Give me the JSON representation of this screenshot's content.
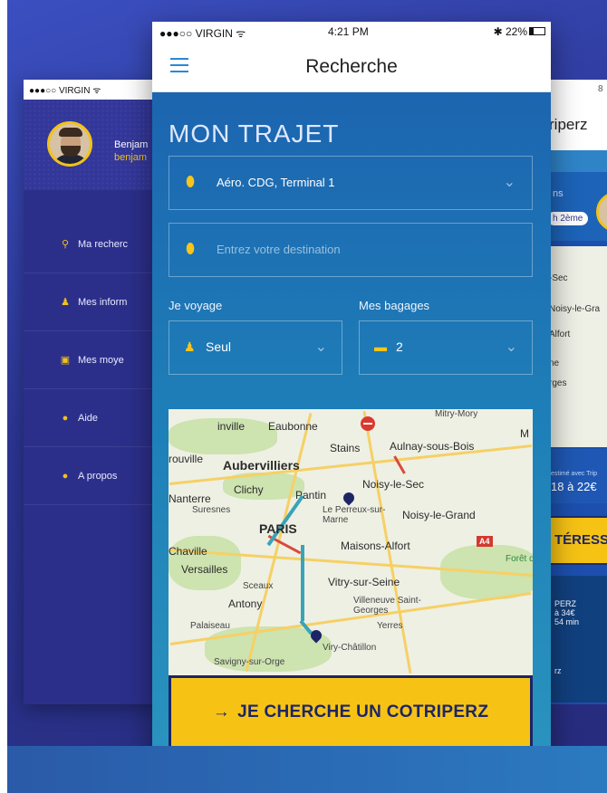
{
  "main": {
    "status": {
      "carrier": "●●●○○ VIRGIN ᯤ",
      "time": "4:21 PM",
      "battery": "✱ 22%"
    },
    "nav_title": "Recherche",
    "section_title": "MON TRAJET",
    "origin_value": "Aéro. CDG, Terminal 1",
    "destination_placeholder": "Entrez votre destination",
    "travel_label": "Je voyage",
    "travel_value": "Seul",
    "bags_label": "Mes bagages",
    "bags_value": "2",
    "cta_arrow": "→",
    "cta_label": "JE CHERCHE UN COTRIPERZ",
    "map_labels": {
      "eaubonne": "Eaubonne",
      "mitry": "Mitry-Mory",
      "stains": "Stains",
      "aulnay": "Aulnay-sous-Bois",
      "rouville": "rouville",
      "aubervilliers": "Aubervilliers",
      "noisy_sec": "Noisy-le-Sec",
      "nanterre": "Nanterre",
      "clichy": "Clichy",
      "pantin": "Pantin",
      "suresnes": "Suresnes",
      "perreux": "Le Perreux-sur-Marne",
      "noisy_grand": "Noisy-le-Grand",
      "paris": "PARIS",
      "chaville": "Chaville",
      "maisons": "Maisons-Alfort",
      "a4": "A4",
      "versailles": "Versailles",
      "foret": "Forêt d'Arm",
      "sceaux": "Sceaux",
      "vitry": "Vitry-sur-Seine",
      "antony": "Antony",
      "villeneuve": "Villeneuve Saint-Georges",
      "yerres": "Yerres",
      "palaiseau": "Palaiseau",
      "viry": "Viry-Châtillon",
      "savigny": "Savigny-sur-Orge",
      "m": "M",
      "ville": "inville"
    }
  },
  "left": {
    "carrier": "●●●○○ VIRGIN ᯤ",
    "name": "Benjam",
    "email": "benjam",
    "menu": [
      {
        "icon": "search-icon",
        "glyph": "🔍",
        "label": "Ma recherc"
      },
      {
        "icon": "person-icon",
        "glyph": "👤",
        "label": "Mes inform"
      },
      {
        "icon": "card-icon",
        "glyph": "▣",
        "label": "Mes moye"
      },
      {
        "icon": "help-icon",
        "glyph": "?",
        "label": "Aide"
      },
      {
        "icon": "info-icon",
        "glyph": "i",
        "label": "A propos"
      }
    ]
  },
  "right": {
    "status": "8",
    "title": "riperz",
    "label_ns": "ns",
    "pill": "h 2ème",
    "map_labels": [
      "-Sec",
      "Noisy-le-Gra",
      "Alfort",
      "ne",
      "rges"
    ],
    "estimate_small": "estimé avec Trip",
    "price": "18 à 22€",
    "cta_partial": "TÉRESSE",
    "card_lines": [
      "PERZ",
      "à 34€",
      "54 min"
    ],
    "footer": "rz"
  },
  "colors": {
    "accent_yellow": "#f6c315",
    "navy": "#1d2566",
    "menu_blue": "#2a88d6"
  }
}
